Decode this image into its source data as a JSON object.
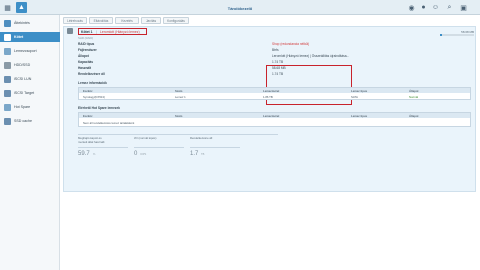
{
  "window": {
    "title": "Tárolókezelő"
  },
  "topbar": {
    "icons": [
      "apps-grid-icon",
      "home-icon",
      "chat-icon",
      "notification-icon",
      "user-icon",
      "search-icon",
      "options-icon"
    ]
  },
  "sidebar": {
    "items": [
      {
        "label": "Áttekintés",
        "icon": "overview-icon",
        "color": "#4f8fc0"
      },
      {
        "label": "Kötet",
        "icon": "volume-icon",
        "color": "#ffffff",
        "active": true
      },
      {
        "label": "Lemezcsoport",
        "icon": "disk-group-icon",
        "color": "#7aa7c9"
      },
      {
        "label": "HDD/SSD",
        "icon": "hdd-icon",
        "color": "#8a9aa6"
      },
      {
        "label": "iSCSI LUN",
        "icon": "iscsi-lun-icon",
        "color": "#6b8fb0"
      },
      {
        "label": "iSCSI Target",
        "icon": "iscsi-target-icon",
        "color": "#6b8fb0"
      },
      {
        "label": "Hot Spare",
        "icon": "hot-spare-icon",
        "color": "#7aa7c9"
      },
      {
        "label": "SSD cache",
        "icon": "ssd-cache-icon",
        "color": "#6b8fb0"
      }
    ]
  },
  "tabs": [
    "Létrehozás",
    "Eltávolítás",
    "Kezelés",
    "Javítás",
    "Konfigurálás"
  ],
  "volume": {
    "name": "Kötet 1",
    "status": "Leromlott (Hiányzó lemez)",
    "subtitle": "SHR (RAID)",
    "usage_text": "58.68 MB",
    "usage_fraction": 0.05
  },
  "info": [
    {
      "label": "RAID típus",
      "value": "Shop (redundancia nélkül)",
      "red": true
    },
    {
      "label": "Fájlrendszer",
      "value": "Btrfs"
    },
    {
      "label": "Állapot",
      "value": "Leromlott (Hiányzó lemez) | Összeállítás újraindítása...",
      "red": false
    },
    {
      "label": "Kapacitás",
      "value": "1.74 TB"
    },
    {
      "label": "Használt",
      "value": "58.68 MB"
    },
    {
      "label": "Rendelkezésre áll",
      "value": "1.74 TB"
    }
  ],
  "disk_info": {
    "title": "Lemez információk",
    "headers": [
      "Eszköz",
      "Szám",
      "Lemezméret",
      "Lemez típus",
      "Állapot"
    ],
    "rows": [
      [
        "Synology(DX513)",
        "Lemez 1",
        "1.86 TB",
        "SATA",
        "Normál"
      ]
    ]
  },
  "hotspare": {
    "title": "Elérhető Hot Spare lemezek",
    "headers": [
      "Eszköz",
      "Szám",
      "Lemezméret",
      "Lemez típus",
      "Állapot"
    ],
    "empty_text": "Nem áll rendelkezésre lemez tartalékként"
  },
  "stats": [
    {
      "label": "Meghajtó kapott és\nmentett által használt",
      "value": "59.7",
      "unit": "%"
    },
    {
      "label": "I/O (normál lépés)",
      "value": "0",
      "unit": "IOPS"
    },
    {
      "label": "Rendelkezésre áll",
      "value": "1.7",
      "unit": "TB"
    }
  ]
}
